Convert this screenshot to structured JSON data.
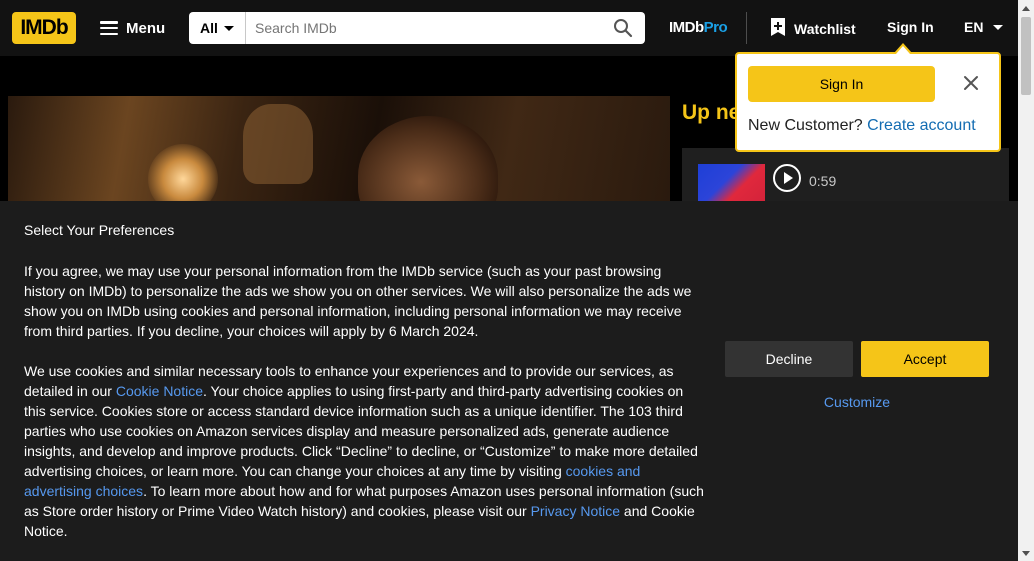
{
  "header": {
    "logo_text": "IMDb",
    "menu_label": "Menu",
    "search_category": "All",
    "search_placeholder": "Search IMDb",
    "imdbpro_prefix": "IMDb",
    "imdbpro_suffix": "Pro",
    "watchlist_label": "Watchlist",
    "signin_label": "Sign In",
    "language": "EN"
  },
  "hero": {
    "upnext_label": "Up ne",
    "video_duration": "0:59"
  },
  "signin_popover": {
    "signin_button": "Sign In",
    "new_customer_text": "New Customer?",
    "create_account_link": "Create account"
  },
  "consent": {
    "title": "Select Your Preferences",
    "paragraph1": "If you agree, we may use your personal information from the IMDb service (such as your past browsing history on IMDb) to personalize the ads we show you on other services. We will also personalize the ads we show you on IMDb using cookies and personal information, including personal information we may receive from third parties. If you decline, your choices will apply by 6 March 2024.",
    "p2_a": "We use cookies and similar necessary tools to enhance your experiences and to provide our services, as detailed in our ",
    "p2_link1": "Cookie Notice",
    "p2_b": ". Your choice applies to using first-party and third-party advertising cookies on this service. Cookies store or access standard device information such as a unique identifier. The 103 third parties who use cookies on Amazon services display and measure personalized ads, generate audience insights, and develop and improve products. Click “Decline” to decline, or “Customize” to make more detailed advertising choices, or learn more. You can change your choices at any time by visiting ",
    "p2_link2": "cookies and advertising choices",
    "p2_c": ". To learn more about how and for what purposes Amazon uses personal information (such as Store order history or Prime Video Watch history) and cookies, please visit our ",
    "p2_link3": "Privacy Notice",
    "p2_d": " and Cookie Notice.",
    "decline_label": "Decline",
    "accept_label": "Accept",
    "customize_label": "Customize"
  },
  "colors": {
    "brand_yellow": "#f5c518",
    "link_blue": "#5799ef",
    "pro_blue": "#1aa0e5"
  }
}
